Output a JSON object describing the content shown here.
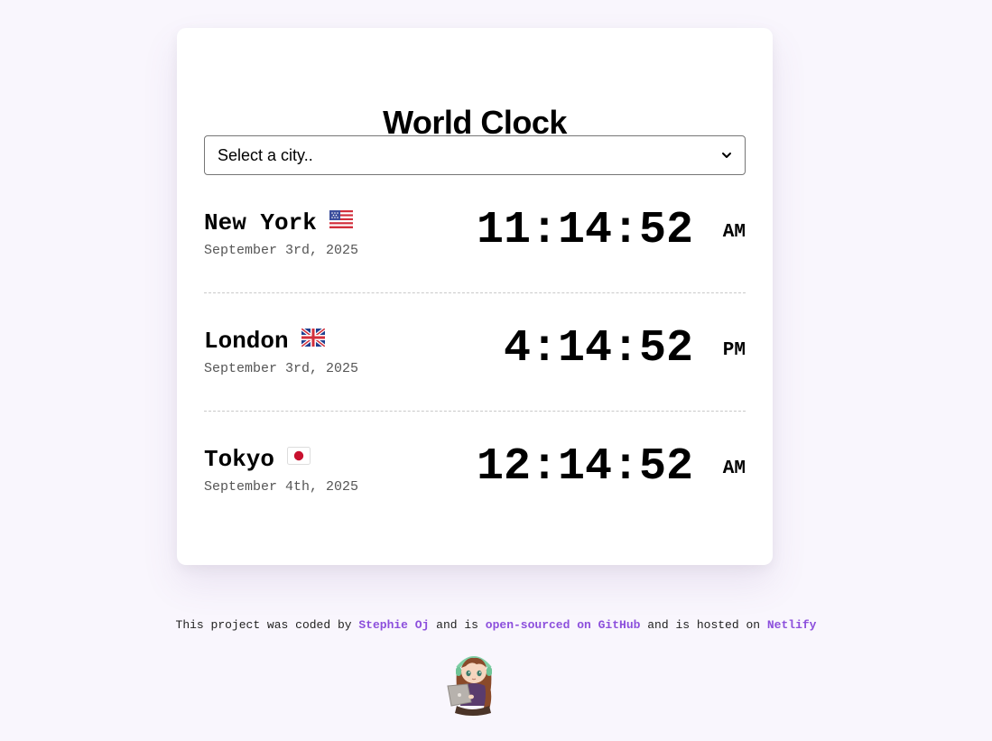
{
  "app": {
    "title": "World Clock"
  },
  "city_select": {
    "selected_label": "Select a city..",
    "icon": "chevron-down-icon"
  },
  "cities": [
    {
      "name": "New York",
      "flag": "us-flag-icon",
      "date": "September 3rd, 2025",
      "time": "11:14:52",
      "ampm": "AM"
    },
    {
      "name": "London",
      "flag": "uk-flag-icon",
      "date": "September 3rd, 2025",
      "time": "4:14:52",
      "ampm": "PM"
    },
    {
      "name": "Tokyo",
      "flag": "japan-flag-icon",
      "date": "September 4th, 2025",
      "time": "12:14:52",
      "ampm": "AM"
    }
  ],
  "footer": {
    "text_1": "This project was coded by ",
    "author_link": "Stephie Oj",
    "text_2": " and is ",
    "github_link": "open-sourced on GitHub",
    "text_3": " and is hosted on ",
    "netlify_link": "Netlify",
    "avatar_icon": "coder-girl-avatar"
  },
  "colors": {
    "page_background": "#f9f6fd",
    "card_background": "#ffffff",
    "link": "#8c4fdc",
    "date_text": "#555555",
    "divider": "#c9c9c9"
  }
}
